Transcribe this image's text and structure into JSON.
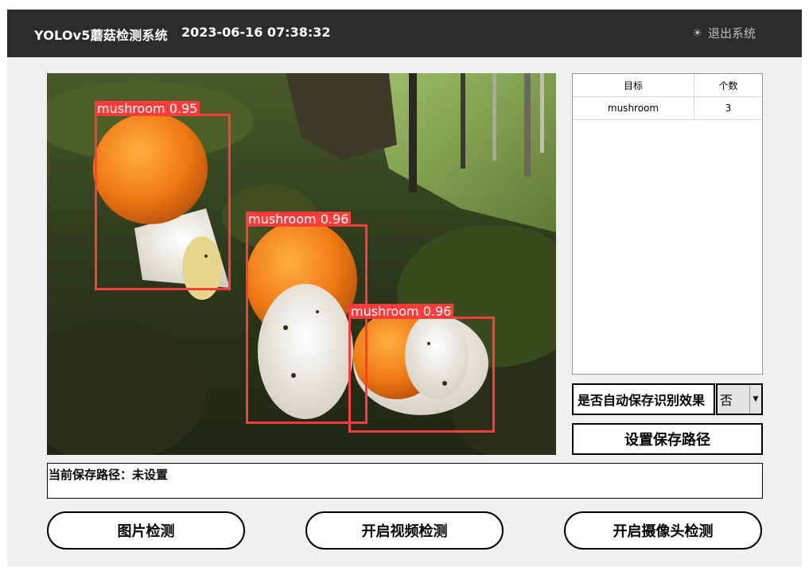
{
  "header": {
    "title": "YOLOv5蘑菇检测系统",
    "datetime": "2023-06-16 07:38:32",
    "exit_label": "退出系统",
    "exit_icon": "sun-icon"
  },
  "detections": [
    {
      "label": "mushroom",
      "confidence": "0.95"
    },
    {
      "label": "mushroom",
      "confidence": "0.96"
    },
    {
      "label": "mushroom",
      "confidence": "0.96"
    }
  ],
  "results_table": {
    "headers": [
      "目标",
      "个数"
    ],
    "rows": [
      [
        "mushroom",
        "3"
      ]
    ]
  },
  "autosave": {
    "label": "是否自动保存识别效果",
    "value": "否"
  },
  "set_path_label": "设置保存路径",
  "current_path_text": "当前保存路径：未设置",
  "buttons": {
    "image_detect": "图片检测",
    "video_detect": "开启视频检测",
    "camera_detect": "开启摄像头检测"
  },
  "colors": {
    "header_bg": "#2c2c2c",
    "detection_box": "#ff3b3b",
    "panel_bg": "#f0f0f0"
  }
}
